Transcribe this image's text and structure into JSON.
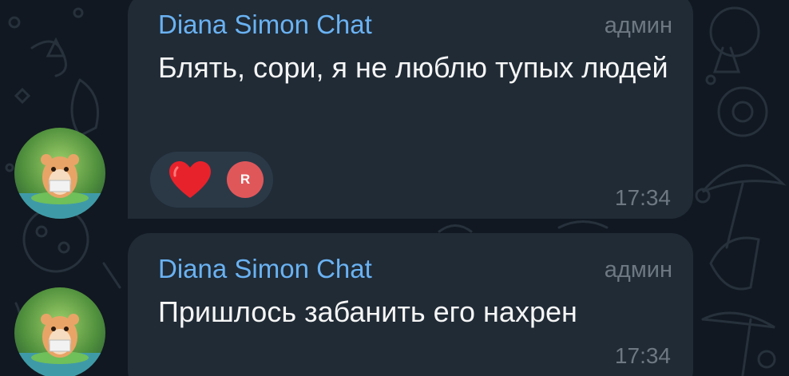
{
  "messages": [
    {
      "sender": "Diana Simon Chat",
      "role": "админ",
      "text": "Блять, сори, я не люблю тупых людей",
      "time": "17:34",
      "reactions": {
        "emoji": "heart",
        "reactor_initial": "R"
      }
    },
    {
      "sender": "Diana Simon Chat",
      "role": "админ",
      "text": "Пришлось забанить его нахрен",
      "time": "17:34"
    }
  ],
  "colors": {
    "background": "#111821",
    "bubble": "#202b36",
    "sender": "#6ab2f2",
    "meta": "#6d7883",
    "reaction_pill": "#2b3947",
    "heart": "#e8222b",
    "reactor_avatar": "#e0575a"
  },
  "icons": {
    "avatar": "hamster-avatar",
    "reaction": "heart-icon"
  }
}
